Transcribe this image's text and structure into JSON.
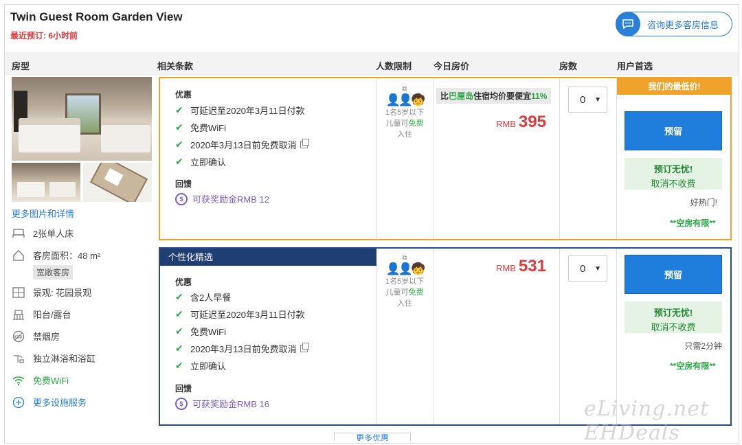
{
  "room": {
    "title": "Twin Guest Room Garden View",
    "recent_booking": "最近预订: 6小时前",
    "consult_label": "咨询更多客房信息"
  },
  "columns": [
    "房型",
    "相关条款",
    "人数限制",
    "今日房价",
    "房数",
    "用户首选"
  ],
  "left": {
    "more_pics": "更多图片和详情",
    "features": {
      "bed": "2张单人床",
      "area": "客房面积：48 m²",
      "area_badge": "宽敞客房",
      "view": "景观: 花园景观",
      "balcony": "阳台/露台",
      "nosmoke": "禁烟房",
      "bath": "独立淋浴和浴缸",
      "wifi": "免费WiFi",
      "more": "更多设施服务"
    }
  },
  "offers": [
    {
      "header": "",
      "section1": "优惠",
      "benefits": [
        "可延迟至2020年3月11日付款",
        "免费WiFi",
        "2020年3月13日前免费取消",
        "立即确认"
      ],
      "section2": "回馈",
      "reward": "可获奖励金RMB 12",
      "people_a": "1名5岁以下",
      "people_b1": "儿童可",
      "people_b2": "免费",
      "people_c": "入住",
      "compare_a": "比",
      "compare_b": "巴厘岛",
      "compare_c": "住宿均价要便宜",
      "compare_d": "11%",
      "currency": "RMB",
      "price": "395",
      "rooms": "0",
      "lowest_label": "我们的最低价!",
      "reserve": "预留",
      "worry_a": "预订无忧!",
      "worry_b": "取消不收费",
      "note": "好热门!",
      "limited": "**空房有限**"
    },
    {
      "header": "个性化精选",
      "section1": "优惠",
      "benefits": [
        "含2人早餐",
        "可延迟至2020年3月11日付款",
        "免费WiFi",
        "2020年3月13日前免费取消",
        "立即确认"
      ],
      "section2": "回馈",
      "reward": "可获奖励金RMB 16",
      "people_a": "1名5岁以下",
      "people_b1": "儿童可",
      "people_b2": "免费",
      "people_c": "入住",
      "currency": "RMB",
      "price": "531",
      "rooms": "0",
      "reserve": "预留",
      "worry_a": "预订无忧!",
      "worry_b": "取消不收费",
      "note": "只需2分钟",
      "limited": "**空房有限**"
    }
  ],
  "footer": {
    "tab": "更多优惠"
  },
  "watermark": "eLiving.net EHDeals",
  "colors": {
    "accent": "#2a7fd8",
    "price": "#e03a3a",
    "orange": "#f0a32a",
    "navy": "#1f3e73",
    "green": "#2aa744"
  }
}
